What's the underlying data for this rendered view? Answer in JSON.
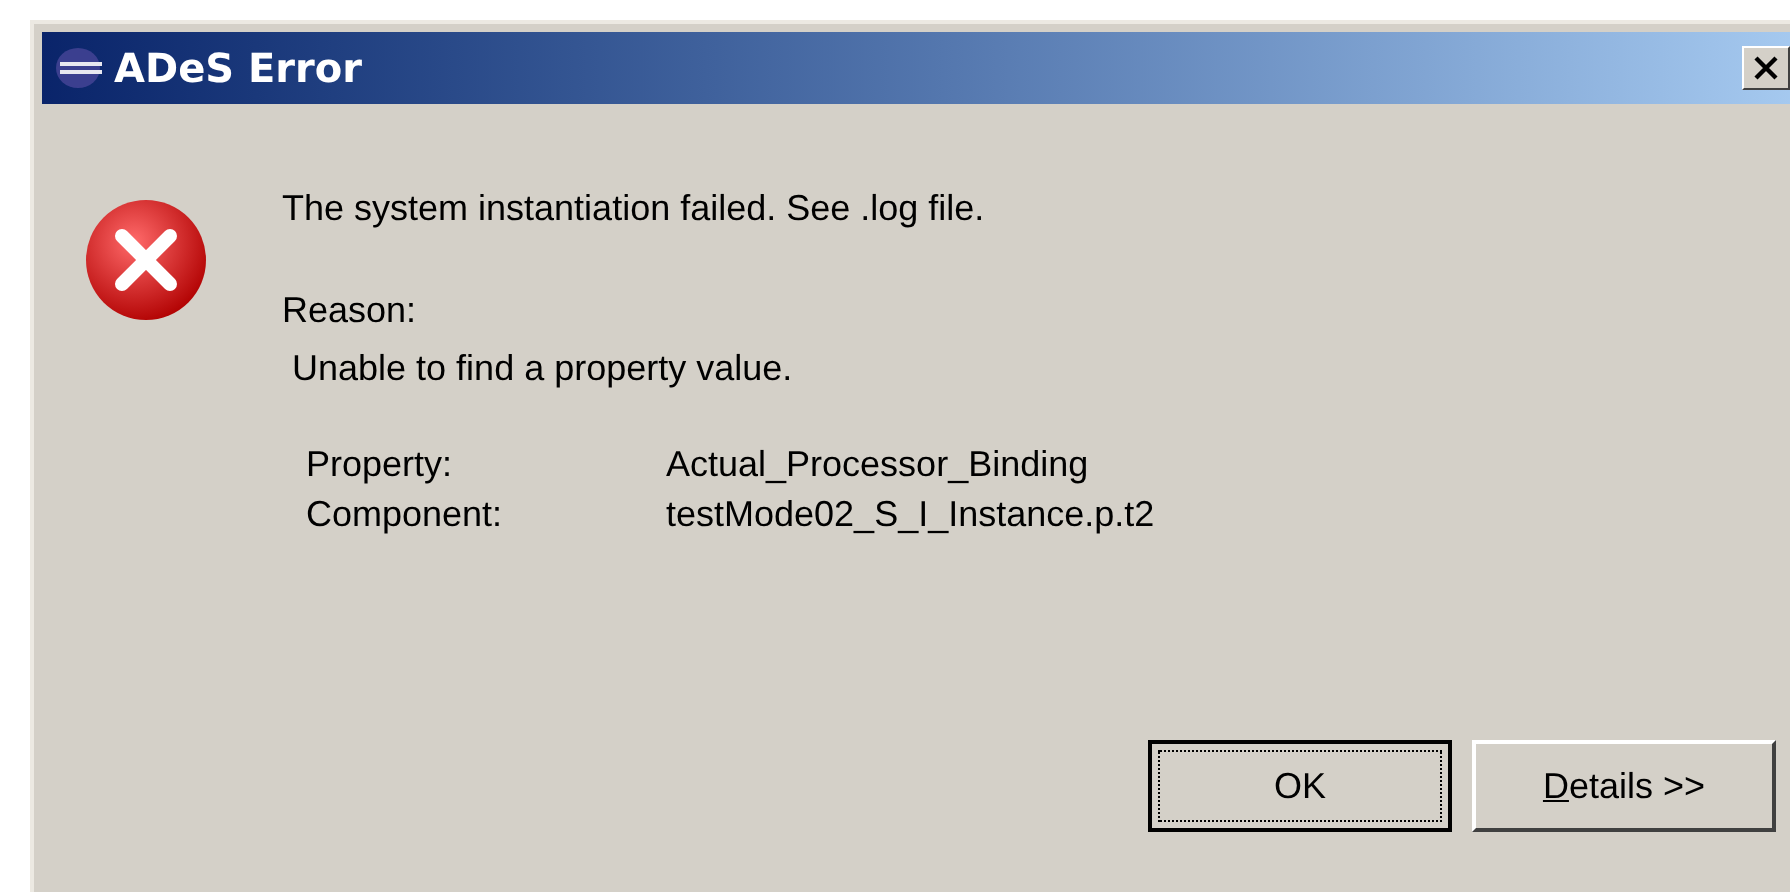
{
  "window": {
    "title": "ADeS Error"
  },
  "message": "The system instantiation failed. See .log file.",
  "reason_label": "Reason:",
  "reason": " Unable to find a property value.",
  "details": [
    {
      "label": "Property:",
      "value": "Actual_Processor_Binding"
    },
    {
      "label": "Component:",
      "value": "testMode02_S_I_Instance.p.t2"
    }
  ],
  "buttons": [
    {
      "label": "OK",
      "focused": true
    },
    {
      "label": "Details >>",
      "focused": false
    }
  ]
}
